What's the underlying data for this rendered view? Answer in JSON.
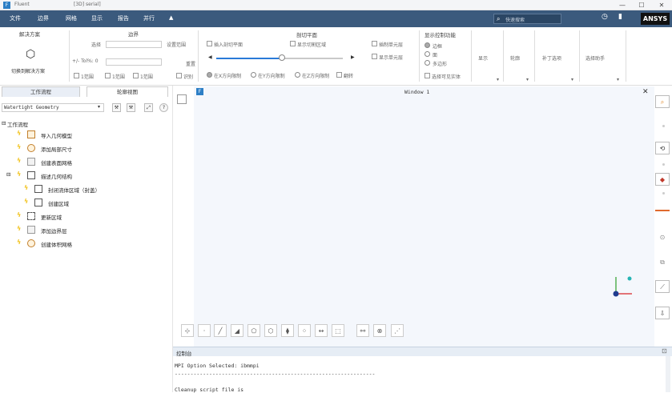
{
  "titlebar": {
    "app": "Fluent",
    "mode": "[3D] serial]"
  },
  "menu": [
    "文件",
    "边界",
    "网格",
    "显示",
    "报告",
    "并行"
  ],
  "search": {
    "placeholder": "快速搜索"
  },
  "brand": "ANSYS",
  "ribbon": {
    "solution": {
      "title": "解决方案",
      "button": "切换到解决方案"
    },
    "boundary": {
      "title": "边界",
      "select_label": "选择",
      "set_range": "设置范围",
      "tol_label": "+/- Tol%: 0",
      "reset": "重置",
      "cb": [
        "1范围",
        "1范围",
        "1范围",
        "识别"
      ]
    },
    "cut_plane": {
      "title": "剖切平面",
      "cb1": "插入剖切平面",
      "cb2": "显示切割区域",
      "cb3": "插制单元层",
      "cb4": "显示单元层",
      "r1": "在X方向限制",
      "r2": "在Y方向限制",
      "r3": "在Z方向限制",
      "flip": "翻转"
    },
    "display_control": {
      "title": "显示控制功能",
      "r1": "边框",
      "r2": "面",
      "r3": "多边形",
      "cb": "选择可见实体"
    },
    "cols": [
      "显示",
      "轮廓",
      "补丁选项",
      "选择助手"
    ]
  },
  "left": {
    "tabs": [
      "工作流程",
      "轮廓视图"
    ],
    "dropdown": "Watertight Geometry",
    "tree_root": "工作流程",
    "tree": [
      "导入几何模型",
      "添加局部尺寸",
      "创建表面网格",
      "描述几何结构",
      "封闭流体区域（封盖）",
      "创建区域",
      "更新区域",
      "添加边界层",
      "创建体积网格"
    ]
  },
  "viewport": {
    "title": "Window 1"
  },
  "console": {
    "header": "控制台",
    "lines": [
      "MPI Option Selected: ibmmpi",
      "----------------------------------------------------------------",
      "",
      "Cleanup script file is"
    ]
  }
}
